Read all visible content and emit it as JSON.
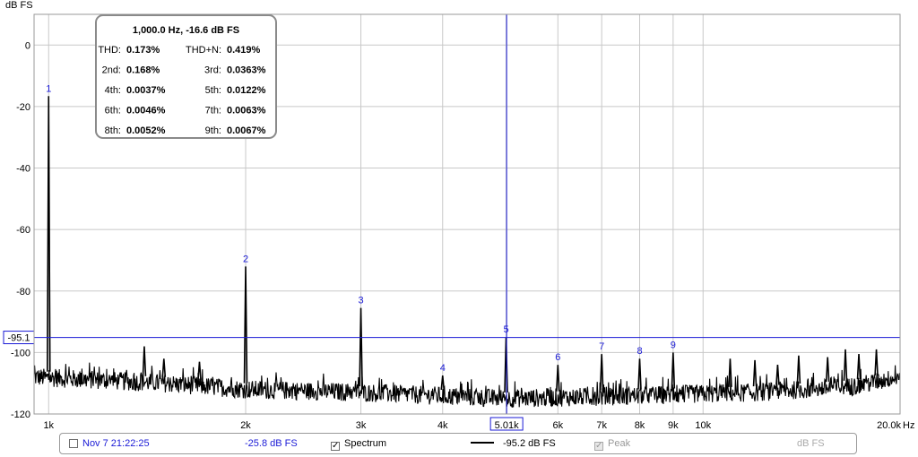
{
  "chart_data": {
    "type": "line",
    "ylabel": "dB FS",
    "xunit": "Hz",
    "xscale": "log",
    "xlim": [
      950,
      20000
    ],
    "ylim": [
      -120,
      10
    ],
    "grid": true,
    "y_ticks": [
      {
        "value": 0,
        "label": "0"
      },
      {
        "value": -20,
        "label": "-20"
      },
      {
        "value": -40,
        "label": "-40"
      },
      {
        "value": -60,
        "label": "-60"
      },
      {
        "value": -80,
        "label": "-80"
      },
      {
        "value": -100,
        "label": "-100"
      },
      {
        "value": -120,
        "label": "-120"
      }
    ],
    "x_ticks": [
      {
        "value": 1000,
        "label": "1k"
      },
      {
        "value": 2000,
        "label": "2k"
      },
      {
        "value": 3000,
        "label": "3k"
      },
      {
        "value": 4000,
        "label": "4k"
      },
      {
        "value": 6000,
        "label": "6k"
      },
      {
        "value": 7000,
        "label": "7k"
      },
      {
        "value": 8000,
        "label": "8k"
      },
      {
        "value": 9000,
        "label": "9k"
      },
      {
        "value": 10000,
        "label": "10k"
      },
      {
        "value": 20000,
        "label": "20.0k"
      }
    ],
    "x_minor_grid": [
      5000
    ],
    "noise_floor": [
      [
        950,
        -108
      ],
      [
        1500,
        -110
      ],
      [
        2000,
        -112
      ],
      [
        3000,
        -113
      ],
      [
        5000,
        -115
      ],
      [
        8000,
        -114
      ],
      [
        12000,
        -113
      ],
      [
        17000,
        -111
      ],
      [
        20000,
        -108
      ]
    ],
    "harmonics": [
      {
        "label": "1",
        "freq": 1000,
        "level": -16.6
      },
      {
        "label": "2",
        "freq": 2000,
        "level": -72
      },
      {
        "label": "3",
        "freq": 3000,
        "level": -85.5
      },
      {
        "label": "4",
        "freq": 4000,
        "level": -107.5
      },
      {
        "label": "5",
        "freq": 5000,
        "level": -95
      },
      {
        "label": "6",
        "freq": 6000,
        "level": -104
      },
      {
        "label": "7",
        "freq": 7000,
        "level": -100.5
      },
      {
        "label": "8",
        "freq": 8000,
        "level": -102
      },
      {
        "label": "9",
        "freq": 9000,
        "level": -100
      }
    ],
    "other_spurs": [
      {
        "freq": 1400,
        "level": -98
      },
      {
        "freq": 1500,
        "level": -102
      },
      {
        "freq": 1700,
        "level": -103
      },
      {
        "freq": 11000,
        "level": -102
      },
      {
        "freq": 12000,
        "level": -102.5
      },
      {
        "freq": 13000,
        "level": -104
      },
      {
        "freq": 14000,
        "level": -101
      },
      {
        "freq": 15500,
        "level": -101.5
      },
      {
        "freq": 16500,
        "level": -99
      },
      {
        "freq": 17300,
        "level": -100.5
      },
      {
        "freq": 18400,
        "level": -99
      }
    ],
    "cursor": {
      "freq": 5010,
      "level": -95.1,
      "x_label": "5.01k",
      "y_label": "-95.1"
    },
    "distortion_box": {
      "title": "1,000.0 Hz, -16.6 dB FS",
      "rows": [
        [
          {
            "k": "THD:",
            "v": "0.173%"
          },
          {
            "k": "THD+N:",
            "v": "0.419%"
          }
        ],
        [
          {
            "k": "2nd:",
            "v": "0.168%"
          },
          {
            "k": "3rd:",
            "v": "0.0363%"
          }
        ],
        [
          {
            "k": "4th:",
            "v": "0.0037%"
          },
          {
            "k": "5th:",
            "v": "0.0122%"
          }
        ],
        [
          {
            "k": "6th:",
            "v": "0.0046%"
          },
          {
            "k": "7th:",
            "v": "0.0063%"
          }
        ],
        [
          {
            "k": "8th:",
            "v": "0.0052%"
          },
          {
            "k": "9th:",
            "v": "0.0067%"
          }
        ]
      ]
    },
    "colors": {
      "trace": "#000000",
      "cursor": "#1a1ad6",
      "grid": "#c8c8c8",
      "box_border": "#8a8a8a"
    }
  },
  "legend": {
    "timestamp": "Nov 7 21:22:25",
    "timestamp_value": "-25.8 dB FS",
    "spectrum_label": "Spectrum",
    "spectrum_value": "-95.2 dB FS",
    "peak_label": "Peak",
    "peak_unit": "dB FS"
  }
}
